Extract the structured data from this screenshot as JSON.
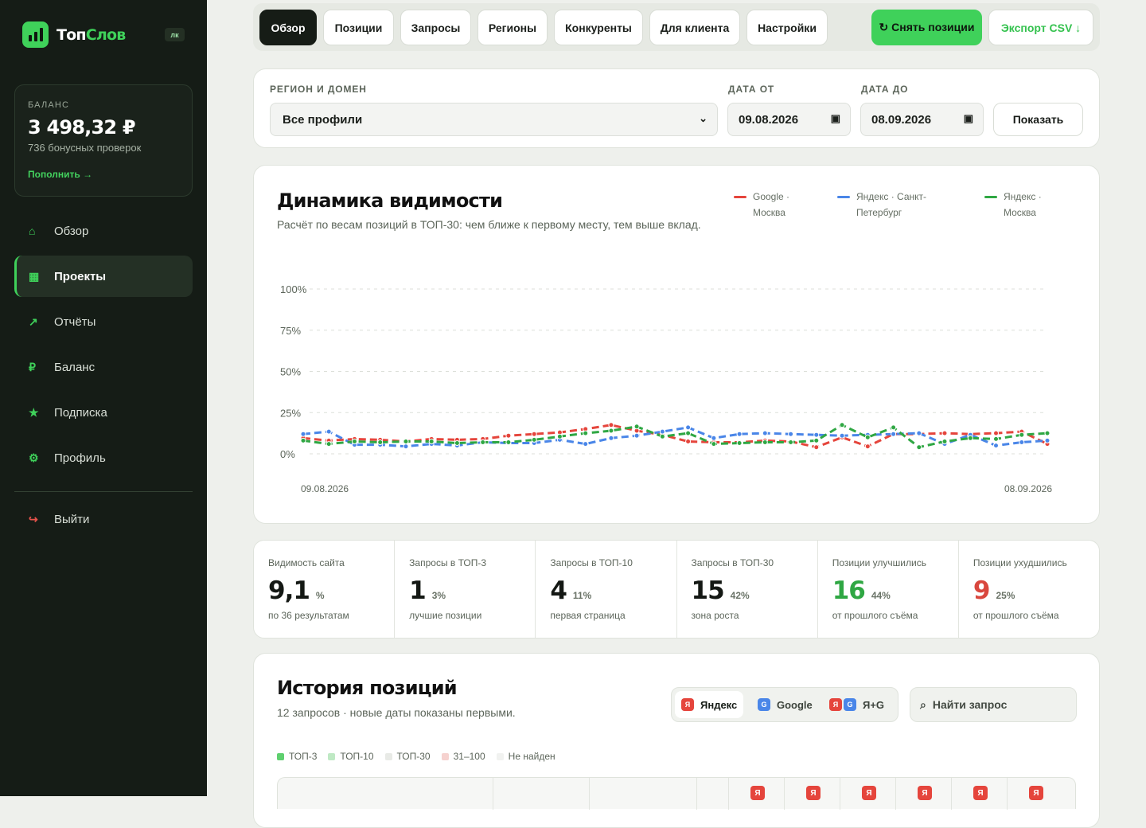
{
  "app": {
    "name_a": "Топ",
    "name_b": "Слов",
    "badge": "лк"
  },
  "balance": {
    "label": "БАЛАНС",
    "amount": "3 498,32 ₽",
    "bonus": "736 бонусных проверок",
    "topup": "Пополнить →"
  },
  "nav": [
    {
      "label": "Обзор",
      "icon": "⌂",
      "icon_name": "home-icon",
      "active": false
    },
    {
      "label": "Проекты",
      "icon": "▦",
      "icon_name": "projects-icon",
      "active": true
    },
    {
      "label": "Отчёты",
      "icon": "↗",
      "icon_name": "trend-icon",
      "active": false
    },
    {
      "label": "Баланс",
      "icon": "₽",
      "icon_name": "ruble-icon",
      "active": false
    },
    {
      "label": "Подписка",
      "icon": "★",
      "icon_name": "star-icon",
      "active": false
    },
    {
      "label": "Профиль",
      "icon": "⚙",
      "icon_name": "gear-icon",
      "active": false
    }
  ],
  "logout": {
    "label": "Выйти",
    "icon": "↪",
    "icon_name": "logout-icon"
  },
  "tabs": [
    "Обзор",
    "Позиции",
    "Запросы",
    "Регионы",
    "Конкуренты",
    "Для клиента",
    "Настройки"
  ],
  "actions": {
    "refresh": "↻ Снять позиции",
    "export": "Экспорт CSV ↓"
  },
  "filters": {
    "region_label": "РЕГИОН И ДОМЕН",
    "region_value": "Все профили",
    "date_from_label": "ДАТА ОТ",
    "date_from": "09.08.2026",
    "date_to_label": "ДАТА ДО",
    "date_to": "08.09.2026",
    "show": "Показать"
  },
  "visibility": {
    "title": "Динамика видимости",
    "subtitle": "Расчёт по весам позиций в ТОП-30: чем ближе к первому месту, тем выше вклад.",
    "legend": [
      {
        "label": "Google · Москва",
        "color": "#e5453c"
      },
      {
        "label": "Яндекс · Санкт-Петербург",
        "color": "#4a86e8"
      },
      {
        "label": "Яндекс · Москва",
        "color": "#2fa743"
      }
    ]
  },
  "chart_data": {
    "type": "line",
    "x_start": "09.08.2026",
    "x_end": "08.09.2026",
    "yticks": [
      "100%",
      "75%",
      "50%",
      "25%",
      "0%"
    ],
    "ylim": [
      0,
      100
    ],
    "grid": true,
    "series": [
      {
        "name": "Google · Москва",
        "color": "#e5453c",
        "values": [
          9.5,
          8,
          9,
          8.5,
          7.5,
          9,
          8.5,
          9,
          11,
          12,
          13,
          15,
          17.5,
          14,
          11.5,
          7.5,
          7,
          7,
          8,
          7.5,
          4,
          10,
          4.5,
          12,
          12,
          12.5,
          12,
          12.5,
          13.5,
          6
        ]
      },
      {
        "name": "Яндекс · Санкт-Петербург",
        "color": "#4a86e8",
        "values": [
          12,
          13.5,
          5.5,
          5.5,
          4.5,
          6,
          5,
          7,
          6.5,
          6.5,
          8.5,
          6,
          9.5,
          11,
          13.5,
          16,
          9.5,
          12,
          12.5,
          12,
          11.5,
          11,
          11.5,
          12,
          12.5,
          6,
          11.5,
          5,
          7,
          8
        ]
      },
      {
        "name": "Яндекс · Москва",
        "color": "#2fa743",
        "values": [
          8,
          6,
          7.5,
          7,
          7.5,
          7.5,
          6.5,
          7,
          7,
          8.5,
          10.5,
          12.5,
          14,
          16.5,
          10.5,
          12.5,
          6,
          6.5,
          7,
          7,
          8,
          17.5,
          10,
          16,
          4,
          7.5,
          9.5,
          9,
          11.5,
          12.5
        ]
      }
    ]
  },
  "stats": [
    {
      "label": "Видимость сайта",
      "value": "9,1",
      "unit": "%",
      "hint": "по 36 результатам",
      "tone": ""
    },
    {
      "label": "Запросы в ТОП-3",
      "value": "1",
      "unit": "3%",
      "hint": "лучшие позиции",
      "tone": ""
    },
    {
      "label": "Запросы в ТОП-10",
      "value": "4",
      "unit": "11%",
      "hint": "первая страница",
      "tone": ""
    },
    {
      "label": "Запросы в ТОП-30",
      "value": "15",
      "unit": "42%",
      "hint": "зона роста",
      "tone": ""
    },
    {
      "label": "Позиции улучшились",
      "value": "16",
      "unit": "44%",
      "hint": "от прошлого съёма",
      "tone": "green"
    },
    {
      "label": "Позиции ухудшились",
      "value": "9",
      "unit": "25%",
      "hint": "от прошлого съёма",
      "tone": "red"
    }
  ],
  "history": {
    "title": "История позиций",
    "subtitle": "12 запросов · новые даты показаны первыми.",
    "engines": [
      {
        "label": "Яндекс",
        "active": true
      },
      {
        "label": "Google",
        "active": false
      },
      {
        "label": "Я+G",
        "active": false
      }
    ],
    "search_placeholder": "Найти запрос",
    "legend": [
      {
        "label": "ТОП-3",
        "color": "#5fd06f"
      },
      {
        "label": "ТОП-10",
        "color": "#bfe9c4"
      },
      {
        "label": "ТОП-30",
        "color": "#e8eae6"
      },
      {
        "label": "31–100",
        "color": "#f6d2cf"
      },
      {
        "label": "Не найден",
        "color": "#f1f2f0"
      }
    ],
    "engine_badge": "Я"
  }
}
